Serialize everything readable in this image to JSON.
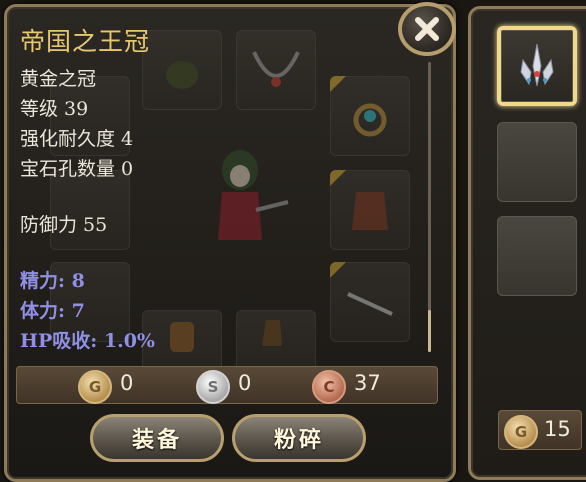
{
  "tooltip": {
    "title": "帝国之王冠",
    "item_name": "黄金之冠",
    "level": "等级 39",
    "durability": "强化耐久度 4",
    "gem_slots": "宝石孔数量 0",
    "defense": "防御力 55",
    "stat_spirit": "精力: 8",
    "stat_stamina": "体力: 7",
    "stat_hp_absorb": "HP吸收: 1.0%"
  },
  "currency": {
    "gold": "0",
    "silver": "0",
    "copper": "37",
    "gold_coin_letter": "G",
    "silver_coin_letter": "S",
    "copper_coin_letter": "C"
  },
  "buttons": {
    "equip": "装备",
    "smash": "粉碎"
  },
  "side": {
    "gold": "15",
    "gold_coin_letter": "G"
  },
  "icons": {
    "close": "close-icon",
    "helmet": "helmet-icon",
    "necklace": "necklace-icon",
    "ring": "ring-icon",
    "armor": "armor-icon",
    "weapon": "weapon-icon",
    "gloves": "gloves-icon",
    "boots": "boots-icon",
    "selected_item": "crown-icon"
  },
  "colors": {
    "title": "#e7c86d",
    "stat": "#8f8fe6",
    "text": "#ebe6da",
    "border": "#b59d6c"
  }
}
